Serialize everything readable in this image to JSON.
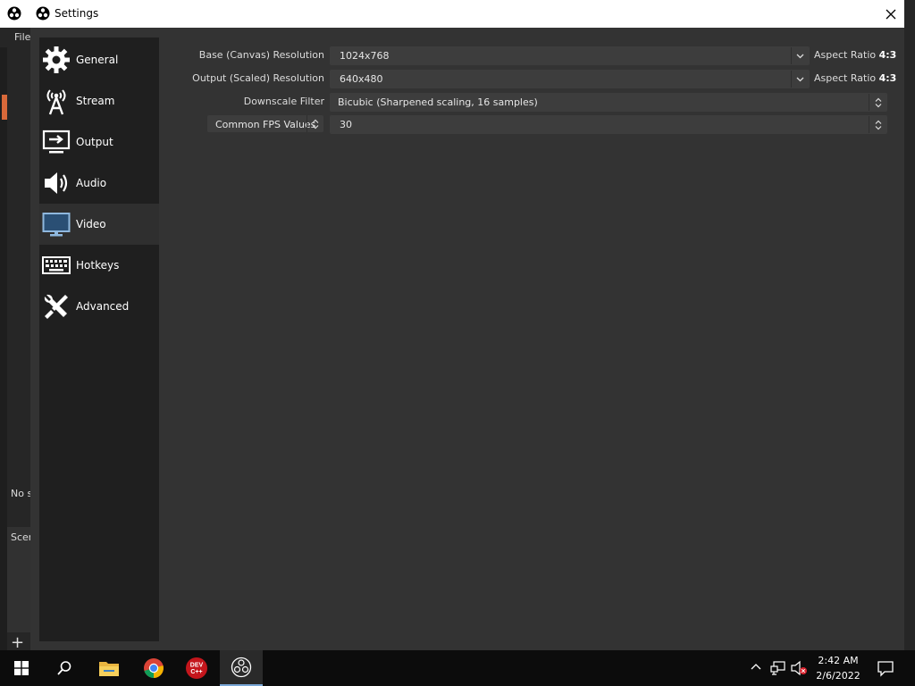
{
  "background_window": {
    "menu_file": "File",
    "no_source": "No s",
    "scenes_label": "Scer"
  },
  "dialog": {
    "title": "Settings",
    "close_glyph": "✕"
  },
  "sidebar": {
    "items": [
      {
        "label": "General",
        "icon": "gear-icon"
      },
      {
        "label": "Stream",
        "icon": "broadcast-icon"
      },
      {
        "label": "Output",
        "icon": "output-monitor-icon"
      },
      {
        "label": "Audio",
        "icon": "speaker-icon"
      },
      {
        "label": "Video",
        "icon": "monitor-icon",
        "active": true
      },
      {
        "label": "Hotkeys",
        "icon": "keyboard-icon"
      },
      {
        "label": "Advanced",
        "icon": "tools-icon"
      }
    ]
  },
  "video": {
    "base_label": "Base (Canvas) Resolution",
    "base_value": "1024x768",
    "base_aspect_prefix": "Aspect Ratio",
    "base_aspect": "4:3",
    "output_label": "Output (Scaled) Resolution",
    "output_value": "640x480",
    "output_aspect_prefix": "Aspect Ratio",
    "output_aspect": "4:3",
    "filter_label": "Downscale Filter",
    "filter_value": "Bicubic (Sharpened scaling, 16 samples)",
    "fps_type": "Common FPS Values",
    "fps_value": "30"
  },
  "taskbar": {
    "apps": [
      "start-icon",
      "search-icon",
      "file-explorer-icon",
      "chrome-icon",
      "devcpp-icon",
      "obs-icon"
    ],
    "devcpp_text": "DEV C++",
    "time": "2:42 AM",
    "date": "2/6/2022"
  },
  "colors": {
    "dialog_bg": "#333333",
    "sidebar_bg": "#1f1f1f",
    "combo_bg": "#3d3d3d",
    "accent": "#d9693a"
  }
}
